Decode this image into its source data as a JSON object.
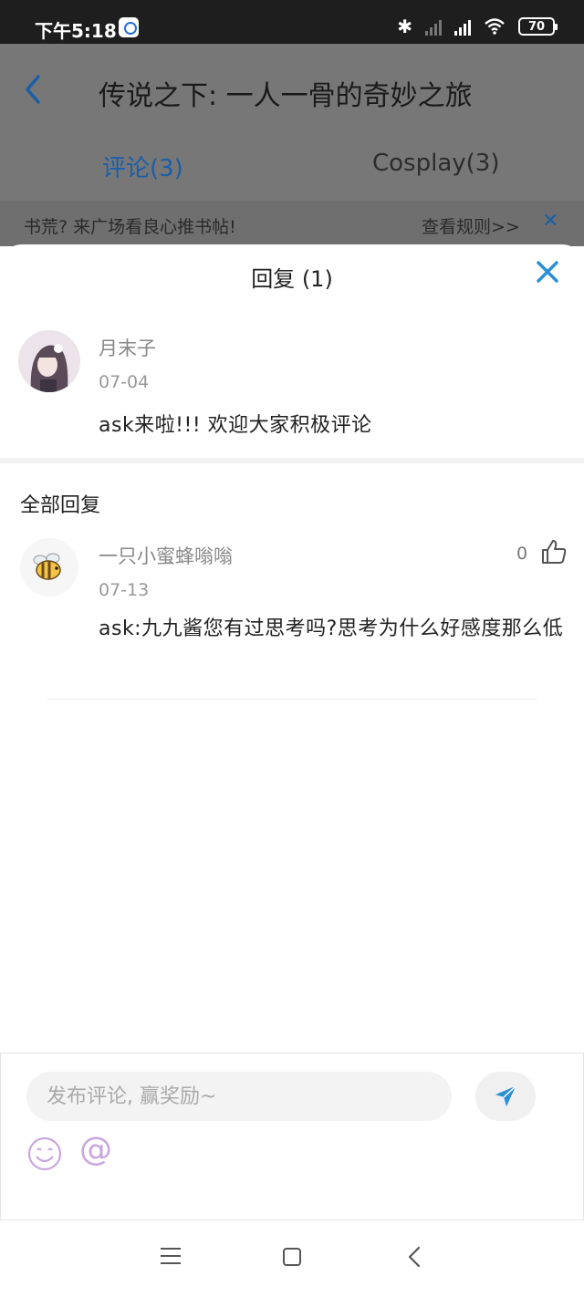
{
  "status_bar": {
    "time": "下午5:18",
    "battery": "70",
    "icons": [
      "baidu-app-icon",
      "bluetooth-icon",
      "signal-icon",
      "hd-signal-icon",
      "wifi-icon",
      "battery-icon"
    ]
  },
  "background_page": {
    "title": "传说之下: 一人一骨的奇妙之旅",
    "tabs": [
      {
        "label": "评论(3)",
        "active": true
      },
      {
        "label": "Cosplay(3)",
        "active": false
      }
    ],
    "banner": {
      "text": "书荒? 来广场看良心推书帖!",
      "rules_link": "查看规则>>"
    }
  },
  "sheet": {
    "title": "回复 (1)",
    "root_comment": {
      "username": "月末子",
      "date": "07-04",
      "text": "ask来啦!!! 欢迎大家积极评论"
    },
    "section_title": "全部回复",
    "replies": [
      {
        "username": "一只小蜜蜂嗡嗡",
        "date": "07-13",
        "text": "ask:九九酱您有过思考吗?思考为什么好感度那么低",
        "likes": "0"
      }
    ]
  },
  "input_bar": {
    "placeholder": "发布评论, 赢奖励~",
    "at_symbol": "@"
  },
  "colors": {
    "accent": "#2b8fd6",
    "send_icon": "#2b8fd6",
    "emoji": "#c9a6e0",
    "overlay": "#777777"
  }
}
